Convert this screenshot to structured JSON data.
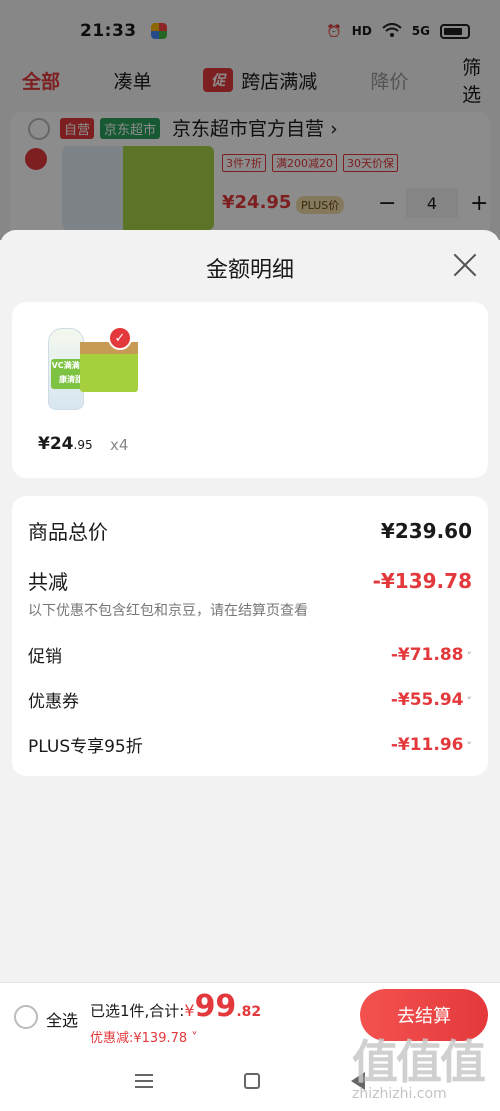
{
  "status_bar": {
    "time": "21:33",
    "icons": [
      "alarm-icon",
      "hd-icon",
      "wifi-icon",
      "signal-5g-icon",
      "battery-icon"
    ],
    "hd_label": "HD",
    "network_label": "5G"
  },
  "tabs": {
    "all": "全部",
    "combo": "凑单",
    "promo_badge": "促",
    "cross_store": "跨店满减",
    "price_drop": "降价",
    "filter": "筛选"
  },
  "shop": {
    "tag_self": "自营",
    "tag_super": "京东超市",
    "name": "京东超市官方自营",
    "chevron": "›",
    "promo_tags": [
      "3件7折",
      "满200减20",
      "30天价保"
    ],
    "price": "¥24.95",
    "plus_tag": "PLUS价",
    "qty": "4",
    "minus": "−",
    "plus": "+"
  },
  "sheet": {
    "title": "金额明细",
    "product": {
      "bottle_label": "VC满满 健康清甜",
      "price_int": "¥24",
      "price_dec": ".95",
      "qty": "x4"
    },
    "details": {
      "goods_total_label": "商品总价",
      "goods_total_value": "¥239.60",
      "total_reduce_label": "共减",
      "total_reduce_value": "-¥139.78",
      "note": "以下优惠不包含红包和京豆，请在结算页查看",
      "promo_label": "促销",
      "promo_value": "-¥71.88",
      "coupon_label": "优惠券",
      "coupon_value": "-¥55.94",
      "plus_label": "PLUS专享95折",
      "plus_value": "-¥11.96",
      "chevron": "˅"
    }
  },
  "bottom_bar": {
    "select_all": "全选",
    "summary_prefix": "已选1件,合计:",
    "total_yen": "¥",
    "total_int": "99",
    "total_dec": ".82",
    "discount": "优惠减:¥139.78 ˅",
    "checkout": "去结算"
  },
  "watermark": {
    "site": "zhizhizhi.com"
  },
  "colors": {
    "accent": "#e4393c",
    "green_tag": "#29a35c",
    "background": "#f2f2f2"
  }
}
